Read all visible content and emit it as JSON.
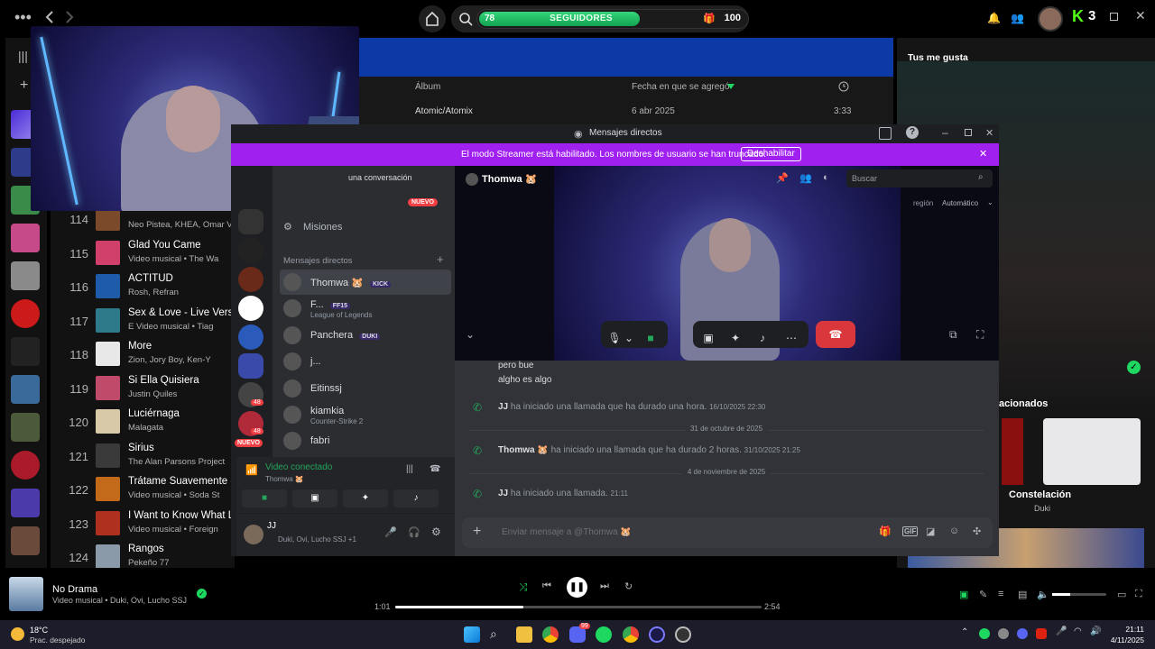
{
  "spotify": {
    "followers": {
      "current": "78",
      "label": "SEGUIDORES",
      "goal": "100",
      "progress": 0.78
    },
    "kick_count": "3",
    "table_headers": {
      "album": "Álbum",
      "date_added": "Fecha en que se agregó",
      "duration_icon": "clock-icon"
    },
    "top_row": {
      "album": "Atomic/Atomix",
      "date": "6 abr 2025",
      "duration": "3:33"
    },
    "tracks": [
      {
        "num": "114",
        "title": "",
        "sub": "Neo Pistea, KHEA, Omar Va",
        "color": "#7a4a2a"
      },
      {
        "num": "115",
        "title": "Glad You Came",
        "sub": "Video musical • The Wa",
        "color": "#d0406a"
      },
      {
        "num": "116",
        "title": "ACTITUD",
        "sub": "Rosh, Refran",
        "color": "#1e5ba8"
      },
      {
        "num": "117",
        "title": "Sex & Love - Live Versio",
        "sub": "E Video musical • Tiag",
        "color": "#2f7a8a"
      },
      {
        "num": "118",
        "title": "More",
        "sub": "Zion, Jory Boy, Ken-Y",
        "color": "#e8e8e8"
      },
      {
        "num": "119",
        "title": "Si Ella Quisiera",
        "sub": "Justin Quiles",
        "color": "#c04a6a"
      },
      {
        "num": "120",
        "title": "Luciérnaga",
        "sub": "Malagata",
        "color": "#d8c9a8"
      },
      {
        "num": "121",
        "title": "Sirius",
        "sub": "The Alan Parsons Project",
        "color": "#3a3a3a"
      },
      {
        "num": "122",
        "title": "Trátame Suavemente - I",
        "sub": "Video musical • Soda St",
        "color": "#c26a1a"
      },
      {
        "num": "123",
        "title": "I Want to Know What Lo",
        "sub": "Video musical • Foreign",
        "color": "#b03020"
      },
      {
        "num": "124",
        "title": "Rangos",
        "sub": "Pekeño 77",
        "color": "#8a9aa8"
      }
    ],
    "right_panel": {
      "title": "Tus me gusta",
      "related": "acionados",
      "card_title": "Constelación",
      "card_sub": "Duki"
    },
    "now_playing": {
      "title": "No Drama",
      "sub": "Video musical • Duki, Ovi, Lucho SSJ",
      "elapsed": "1:01",
      "total": "2:54",
      "progress": 0.35
    }
  },
  "discord": {
    "window_title": "Mensajes directos",
    "streamer_banner": "El modo Streamer está habilitado. Los nombres de usuario se han truncado.",
    "disable_button": "Deshabilitar",
    "search_placeholder": "una conversación",
    "new_badge": "NUEVO",
    "missions": "Misiones",
    "dm_header": "Mensajes directos",
    "dms": [
      {
        "name": "Thomwa 🐹",
        "tag": "KICK",
        "sub": ""
      },
      {
        "name": "F...",
        "tag": "FF15",
        "sub": "League of Legends"
      },
      {
        "name": "Panchera",
        "tag": "DUKI",
        "sub": ""
      },
      {
        "name": "j...",
        "tag": "",
        "sub": ""
      },
      {
        "name": "Eitinssj",
        "tag": "",
        "sub": ""
      },
      {
        "name": "kiamkia",
        "tag": "",
        "sub": "Counter-Strike 2"
      },
      {
        "name": "fabri",
        "tag": "",
        "sub": ""
      }
    ],
    "voice": {
      "status": "Video conectado",
      "channel": "Thomwa 🐹"
    },
    "user": {
      "name": "JJ",
      "activity": "Duki, Ovi, Lucho SSJ +1"
    },
    "call": {
      "peer": "Thomwa 🐹",
      "search": "Buscar",
      "region_label": "región",
      "region_value": "Automático"
    },
    "messages": {
      "m1": "pero bue",
      "m2": "algho es algo",
      "c1_user": "JJ",
      "c1_text": "ha iniciado una llamada que ha durado una hora.",
      "c1_ts": "16/10/2025 22:30",
      "d1": "31 de octubre de 2025",
      "c2_user": "Thomwa 🐹",
      "c2_text": "ha iniciado una llamada que ha durado 2 horas.",
      "c2_ts": "31/10/2025 21:25",
      "d2": "4 de noviembre de 2025",
      "c3_user": "JJ",
      "c3_text": "ha iniciado una llamada.",
      "c3_ts": "21:11"
    },
    "composer_placeholder": "Enviar mensaje a @Thomwa 🐹",
    "server_badges": [
      "48",
      "48"
    ]
  },
  "taskbar": {
    "weather_temp": "18°C",
    "weather_desc": "Prac. despejado",
    "time": "21:11",
    "date": "4/11/2025",
    "discord_badge": "99"
  }
}
